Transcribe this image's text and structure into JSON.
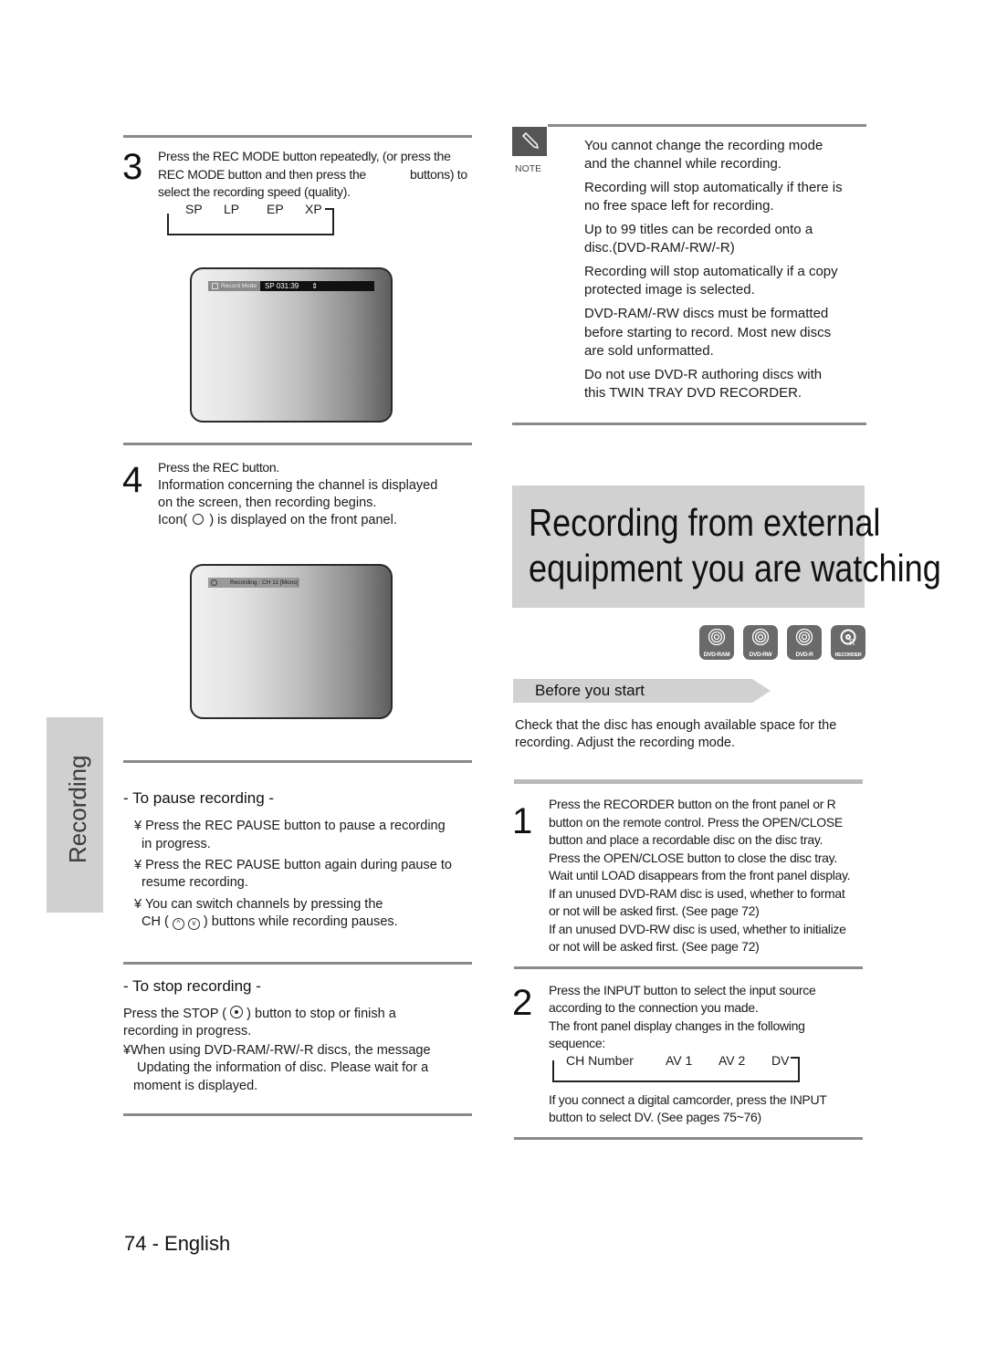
{
  "step3": {
    "number": "3",
    "line1": "Press the REC MODE button repeatedly, (or press the",
    "line2a": "REC MODE button and then press the",
    "line2b": "buttons) to",
    "line3": "select the recording speed (quality).",
    "sequence": [
      "SP",
      "LP",
      "EP",
      "XP"
    ],
    "osd": {
      "label": "Record Mode",
      "value": "SP 031:39",
      "arrow": "⇕"
    }
  },
  "step4": {
    "number": "4",
    "lines": [
      "Press the REC button.",
      "Information concerning the channel is displayed",
      "on the screen, then recording begins."
    ],
    "icon_line_a": "Icon(",
    "icon_line_b": ") is displayed on the front panel.",
    "osd": {
      "text": "Recording : CH 11  [Mono]"
    }
  },
  "pause": {
    "heading": "- To pause recording -",
    "bullets": [
      {
        "l1": "¥ Press the REC PAUSE button to pause a recording",
        "l2": "in progress."
      },
      {
        "l1": "¥ Press the REC PAUSE button again during pause to",
        "l2": "resume recording."
      },
      {
        "l1": "¥ You can switch channels by pressing the",
        "l2a": "CH (",
        "l2b": ") buttons while recording pauses."
      }
    ]
  },
  "stop": {
    "heading": "- To stop recording -",
    "p1a": "Press the STOP (",
    "p1b": ") button to stop or finish a",
    "p1c": "recording in progress.",
    "p2": [
      "¥When using DVD-RAM/-RW/-R discs, the message",
      "Updating the information of disc. Please wait for a",
      "moment  is displayed."
    ]
  },
  "sidebar": {
    "label": "Recording"
  },
  "note": {
    "label": "NOTE",
    "items": [
      [
        "You cannot change the recording mode",
        "and the channel while recording."
      ],
      [
        "Recording will stop automatically if there is",
        "no free space left for recording."
      ],
      [
        "Up to 99 titles can be recorded onto a",
        "disc.(DVD-RAM/-RW/-R)"
      ],
      [
        "Recording will stop automatically if a copy",
        "protected image is selected."
      ],
      [
        "DVD-RAM/-RW discs must be formatted",
        "before starting to record. Most new discs",
        "are sold unformatted."
      ],
      [
        "Do not use DVD-R authoring discs with",
        "this TWIN TRAY DVD RECORDER."
      ]
    ]
  },
  "section": {
    "title_line1": "Recording from external",
    "title_line2": "equipment you are watching",
    "disc_icons": [
      {
        "icon": "dvd-ram-disc-icon",
        "label": "DVD-RAM"
      },
      {
        "icon": "dvd-rw-disc-icon",
        "label": "DVD-RW"
      },
      {
        "icon": "dvd-r-disc-icon",
        "label": "DVD-R"
      },
      {
        "icon": "recorder-disc-icon",
        "label": "RECORDER"
      }
    ],
    "before_label": "Before you start",
    "before_text": [
      "Check that the disc has enough available space for the",
      "recording. Adjust the recording mode."
    ]
  },
  "rstep1": {
    "number": "1",
    "lines": [
      "Press the RECORDER button on the front panel or R",
      "button on the remote control. Press the OPEN/CLOSE",
      "button and place a recordable disc on the disc tray.",
      "Press the OPEN/CLOSE button to close the disc tray.",
      "Wait until LOAD disappears from the front panel display.",
      "If an unused DVD-RAM disc is used, whether to format",
      "or not will be asked first. (See page 72)",
      "If an unused DVD-RW disc is used, whether to initialize",
      "or not will be asked first. (See page 72)"
    ]
  },
  "rstep2": {
    "number": "2",
    "lines": [
      "Press the INPUT button to select the input source",
      "according to the connection you made.",
      "The front panel display changes in the following",
      "sequence:"
    ],
    "sequence": [
      "CH Number",
      "AV 1",
      "AV 2",
      "DV"
    ],
    "after": [
      "If you connect a digital camcorder, press the INPUT",
      "button to select DV. (See pages 75~76)"
    ]
  },
  "footer": {
    "page": "74 - English"
  }
}
